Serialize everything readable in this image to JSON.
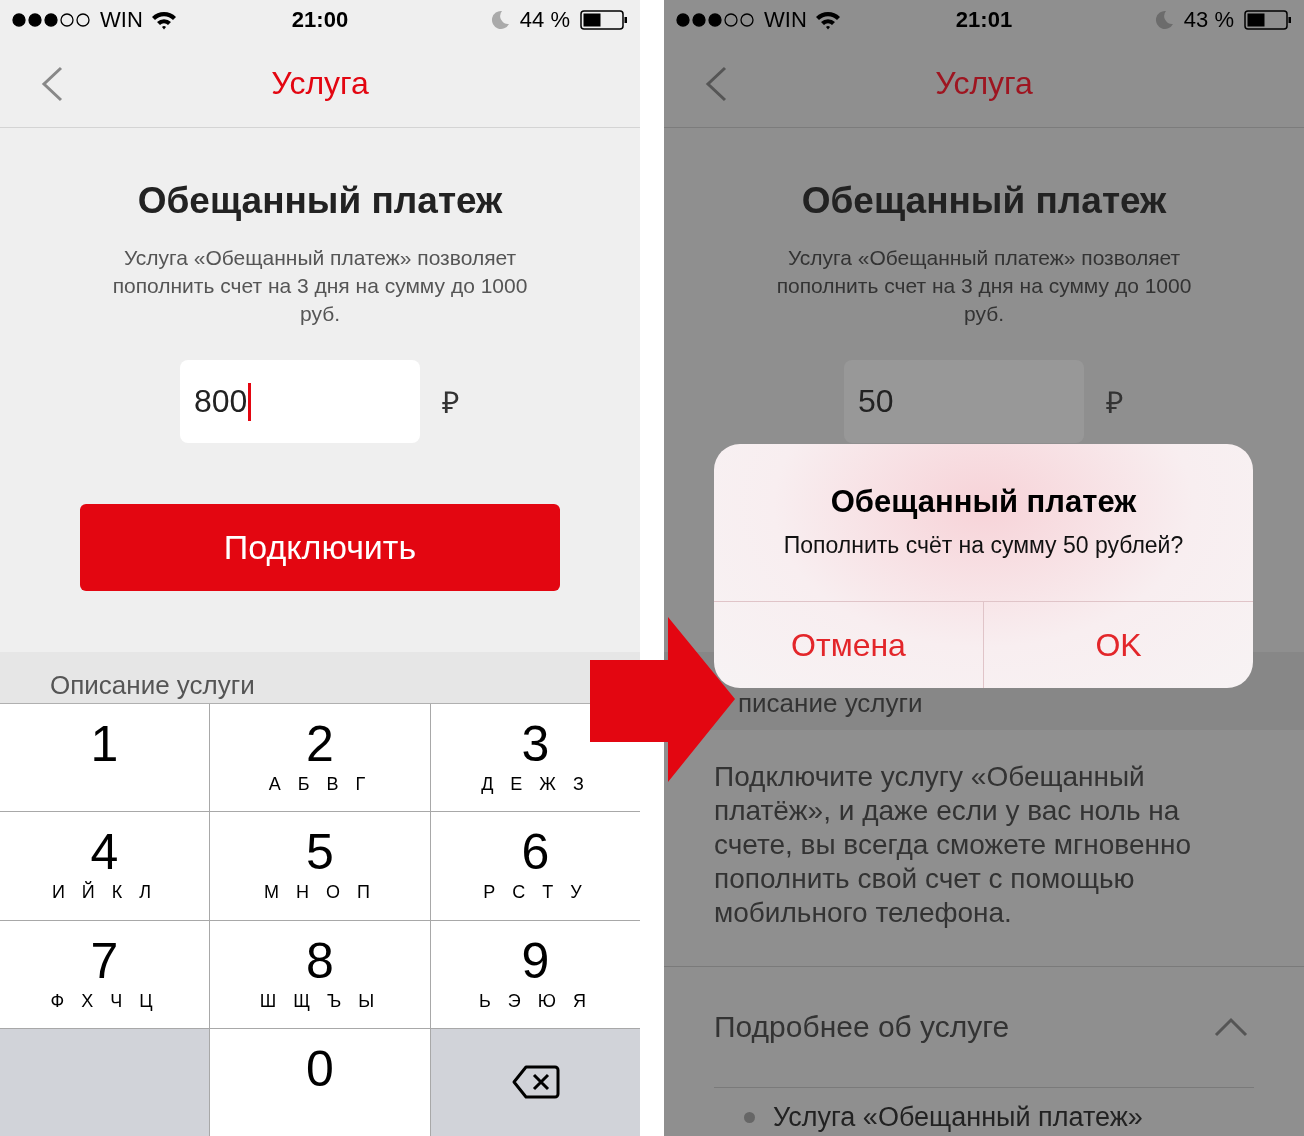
{
  "screens": [
    {
      "dimmed": false,
      "status_bar": {
        "carrier": "WIN",
        "time": "21:00",
        "battery": "44 %"
      },
      "nav": {
        "title": "Услуга"
      },
      "heading": "Обещанный платеж",
      "description": "Услуга «Обещанный платеж» позволяет пополнить счет на 3 дня на сумму до 1000 руб.",
      "amount": {
        "value": "800",
        "focused": true
      },
      "currency": "₽",
      "connect_button": "Подключить",
      "section_title": "Описание услуги",
      "keypad": [
        {
          "kind": "digit",
          "digit": "1"
        },
        {
          "kind": "digit",
          "digit": "2",
          "letters": "А Б В Г"
        },
        {
          "kind": "digit",
          "digit": "3",
          "letters": "Д Е Ж З"
        },
        {
          "kind": "digit",
          "digit": "4",
          "letters": "И Й К Л"
        },
        {
          "kind": "digit",
          "digit": "5",
          "letters": "М Н О П"
        },
        {
          "kind": "digit",
          "digit": "6",
          "letters": "Р С Т У"
        },
        {
          "kind": "digit",
          "digit": "7",
          "letters": "Ф Х Ч Ц"
        },
        {
          "kind": "digit",
          "digit": "8",
          "letters": "Ш Щ Ъ Ы"
        },
        {
          "kind": "digit",
          "digit": "9",
          "letters": "Ь Э Ю Я"
        },
        {
          "kind": "blank"
        },
        {
          "kind": "digit",
          "digit": "0"
        },
        {
          "kind": "delete"
        }
      ]
    },
    {
      "dimmed": true,
      "status_bar": {
        "carrier": "WIN",
        "time": "21:01",
        "battery": "43 %"
      },
      "nav": {
        "title": "Услуга"
      },
      "heading": "Обещанный платеж",
      "description": "Услуга «Обещанный платеж» позволяет пополнить счет на 3 дня на сумму до 1000 руб.",
      "amount": {
        "value": "50",
        "focused": false
      },
      "currency": "₽",
      "section_title": "писание услуги",
      "body": "Подключите услугу «Обещанный платёж», и даже если у вас ноль на счете, вы всегда сможете мгновенно пополнить свой счет с помощью мобильного телефона.",
      "details": {
        "title": "Подробнее об услуге",
        "expanded": true,
        "items": [
          "Услуга «Обещанный платеж»"
        ]
      },
      "alert": {
        "title": "Обещанный платеж",
        "message": "Пополнить счёт на сумму 50 рублей?",
        "buttons": [
          "Отмена",
          "OK"
        ]
      }
    }
  ]
}
